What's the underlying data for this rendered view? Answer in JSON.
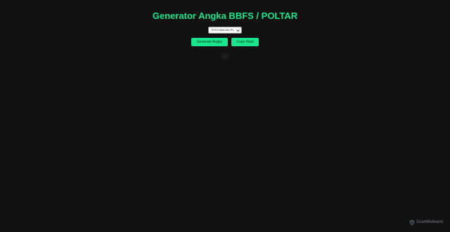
{
  "header": {
    "title": "Generator Angka BBFS / POLTAR"
  },
  "market_select": {
    "selected": "TOTO MACAU P1"
  },
  "actions": {
    "generate_label": "Generate Angka",
    "copy_label": "Copy Hasil"
  },
  "watermark": {
    "label": "ScanMalware"
  },
  "colors": {
    "background": "#121212",
    "accent": "#19e68c"
  },
  "icons": {
    "select_arrow": "chevron-down-icon",
    "watermark_logo": "shield-icon"
  }
}
